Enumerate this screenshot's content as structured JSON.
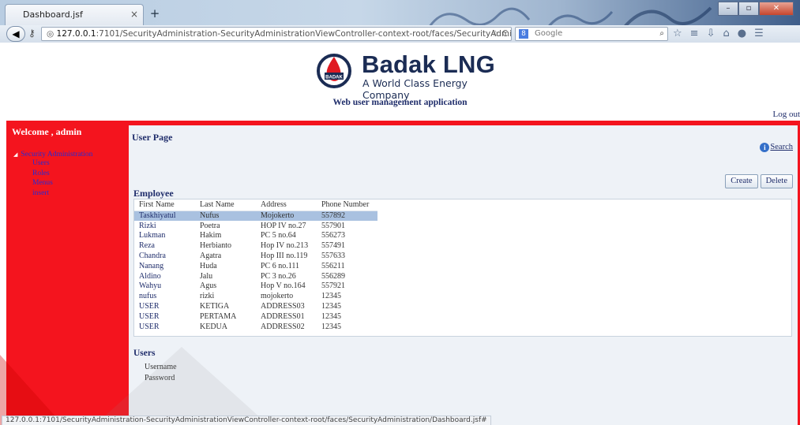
{
  "browser": {
    "tab_title": "Dashboard.jsf",
    "tab_close": "×",
    "new_tab": "+",
    "url_host": "127.0.0.1",
    "url_rest": ":7101/SecurityAdministration-SecurityAdministrationViewController-context-root/faces/SecurityAdministration/Dashboard.jsf",
    "search_placeholder": "Google",
    "status_url": "127.0.0.1:7101/SecurityAdministration-SecurityAdministrationViewController-context-root/faces/SecurityAdministration/Dashboard.jsf#"
  },
  "header": {
    "brand": "Badak LNG",
    "tagline": "A World Class Energy Company",
    "logo_mark": "BADAK",
    "app_title": "Web user management application",
    "logout": "Log out"
  },
  "sidebar": {
    "welcome": "Welcome , admin",
    "root": "Security Administration",
    "items": [
      "Users",
      "Roles",
      "Menus",
      "insert"
    ]
  },
  "main": {
    "page_title": "User Page",
    "search_label": "Search",
    "create_label": "Create",
    "delete_label": "Delete",
    "employee_title": "Employee",
    "columns": [
      "First Name",
      "Last Name",
      "Address",
      "Phone Number"
    ],
    "rows": [
      [
        "Taskhiyatul",
        "Nufus",
        "Mojokerto",
        "557892"
      ],
      [
        "Rizki",
        "Poetra",
        "HOP IV no.27",
        "557901"
      ],
      [
        "Lukman",
        "Hakim",
        "PC 5 no.64",
        "556273"
      ],
      [
        "Reza",
        "Herbianto",
        "Hop IV no.213",
        "557491"
      ],
      [
        "Chandra",
        "Agatra",
        "Hop III no.119",
        "557633"
      ],
      [
        "Nanang",
        "Huda",
        "PC 6 no.111",
        "556211"
      ],
      [
        "Aldino",
        "Jalu",
        "PC 3 no.26",
        "556289"
      ],
      [
        "Wahyu",
        "Agus",
        "Hop V no.164",
        "557921"
      ],
      [
        "nufus",
        "rizki",
        "mojokerto",
        "12345"
      ],
      [
        "USER",
        "KETIGA",
        "ADDRESS03",
        "12345"
      ],
      [
        "USER",
        "PERTAMA",
        "ADDRESS01",
        "12345"
      ],
      [
        "USER",
        "KEDUA",
        "ADDRESS02",
        "12345"
      ]
    ],
    "users_title": "Users",
    "username_label": "Username",
    "password_label": "Password"
  },
  "colors": {
    "accent_red": "#f4141e",
    "selected_row": "#a9c1e0",
    "brand_navy": "#1b2c54"
  }
}
